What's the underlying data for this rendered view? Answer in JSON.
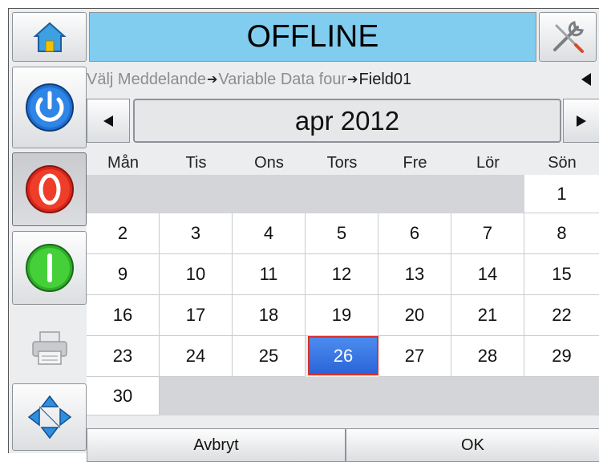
{
  "header": {
    "status": "OFFLINE",
    "status_color": "#80cdef"
  },
  "sidebar": {
    "items": [
      {
        "icon": "home-icon"
      },
      {
        "icon": "power-icon"
      },
      {
        "icon": "stop-icon"
      },
      {
        "icon": "start-icon"
      },
      {
        "icon": "printer-icon"
      },
      {
        "icon": "navigation-arrows-icon"
      }
    ]
  },
  "breadcrumb": {
    "items": [
      "Välj Meddelande",
      "Variable Data four",
      "Field01"
    ],
    "separator": "➔"
  },
  "calendar": {
    "month": "apr 2012",
    "weekdays": [
      "Mån",
      "Tis",
      "Ons",
      "Tors",
      "Fre",
      "Lör",
      "Sön"
    ],
    "days": [
      "1",
      "2",
      "3",
      "4",
      "5",
      "6",
      "7",
      "8",
      "9",
      "10",
      "11",
      "12",
      "13",
      "14",
      "15",
      "16",
      "17",
      "18",
      "19",
      "20",
      "21",
      "22",
      "23",
      "24",
      "25",
      "26",
      "27",
      "28",
      "29",
      "30"
    ],
    "selected_day": "26",
    "selected_color": "#3b7be6"
  },
  "actions": {
    "cancel_label": "Avbryt",
    "ok_label": "OK"
  }
}
